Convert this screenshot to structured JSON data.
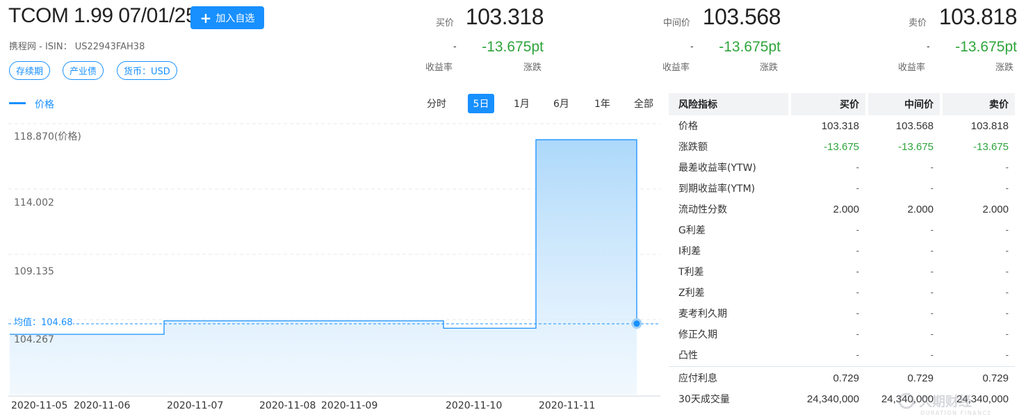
{
  "header": {
    "title": "TCOM 1.99 07/01/25",
    "add_button": "加入自选",
    "subtitle": "携程网 - ISIN： US22943FAH38",
    "tags": [
      "存续期",
      "产业债",
      "货币：USD"
    ]
  },
  "quotes": [
    {
      "label": "买价",
      "price": "103.318",
      "yield": "-",
      "change": "-13.675pt",
      "yield_label": "收益率",
      "change_label": "涨跌"
    },
    {
      "label": "中间价",
      "price": "103.568",
      "yield": "-",
      "change": "-13.675pt",
      "yield_label": "收益率",
      "change_label": "涨跌"
    },
    {
      "label": "卖价",
      "price": "103.818",
      "yield": "-",
      "change": "-13.675pt",
      "yield_label": "收益率",
      "change_label": "涨跌"
    }
  ],
  "chart": {
    "legend": "价格",
    "periods": [
      "分时",
      "5日",
      "1月",
      "6月",
      "1年",
      "全部"
    ],
    "active_period": "5日",
    "avg_label": "均值：104.68",
    "y_top_label": "118.870(价格)",
    "x_labels": [
      "2020-11-05",
      "2020-11-06",
      "2020-11-07",
      "2020-11-08",
      "2020-11-09",
      "2020-11-10",
      "2020-11-11"
    ]
  },
  "chart_data": {
    "type": "area",
    "series": [
      {
        "name": "价格",
        "values": [
          103.9,
          103.9,
          104.9,
          104.9,
          104.9,
          104.9,
          104.35,
          104.35,
          118.4,
          118.4,
          104.7
        ]
      }
    ],
    "x": [
      "2020-11-05",
      "2020-11-05",
      "2020-11-06",
      "2020-11-07",
      "2020-11-08",
      "2020-11-09",
      "2020-11-10",
      "2020-11-10",
      "2020-11-10",
      "2020-11-11",
      "2020-11-11"
    ],
    "y_ticks": [
      "118.870(价格)",
      "114.002",
      "109.135",
      "104.267"
    ],
    "ylim": [
      99.4,
      118.87
    ],
    "average": 104.68,
    "grid": true,
    "accent_color": "#1890ff",
    "fill_color": "#bfe1fb"
  },
  "table": {
    "headers": [
      "风险指标",
      "买价",
      "中间价",
      "卖价"
    ],
    "rows": [
      {
        "label": "价格",
        "values": [
          "103.318",
          "103.568",
          "103.818"
        ],
        "style": "num"
      },
      {
        "label": "涨跌额",
        "values": [
          "-13.675",
          "-13.675",
          "-13.675"
        ],
        "style": "green"
      },
      {
        "label": "最差收益率(YTW)",
        "values": [
          "-",
          "-",
          "-"
        ],
        "style": "dash"
      },
      {
        "label": "到期收益率(YTM)",
        "values": [
          "-",
          "-",
          "-"
        ],
        "style": "dash"
      },
      {
        "label": "流动性分数",
        "values": [
          "2.000",
          "2.000",
          "2.000"
        ],
        "style": "num"
      },
      {
        "label": "G利差",
        "values": [
          "-",
          "-",
          "-"
        ],
        "style": "dash"
      },
      {
        "label": "I利差",
        "values": [
          "-",
          "-",
          "-"
        ],
        "style": "dash"
      },
      {
        "label": "T利差",
        "values": [
          "-",
          "-",
          "-"
        ],
        "style": "dash"
      },
      {
        "label": "Z利差",
        "values": [
          "-",
          "-",
          "-"
        ],
        "style": "dash"
      },
      {
        "label": "麦考利久期",
        "values": [
          "-",
          "-",
          "-"
        ],
        "style": "dash"
      },
      {
        "label": "修正久期",
        "values": [
          "-",
          "-",
          "-"
        ],
        "style": "dash"
      },
      {
        "label": "凸性",
        "values": [
          "-",
          "-",
          "-"
        ],
        "style": "dash"
      }
    ],
    "footer_rows": [
      {
        "label": "应付利息",
        "values": [
          "0.729",
          "0.729",
          "0.729"
        ],
        "style": "num"
      },
      {
        "label": "30天成交量",
        "values": [
          "24,340,000",
          "24,340,000",
          "24,340,000"
        ],
        "style": "num"
      }
    ]
  },
  "watermark": {
    "main": "久期财经",
    "sub": "DURATION FINANCE"
  },
  "colors": {
    "accent": "#1890ff",
    "up_down_green": "#2ea43b",
    "header_bg": "#f2f3f5"
  }
}
